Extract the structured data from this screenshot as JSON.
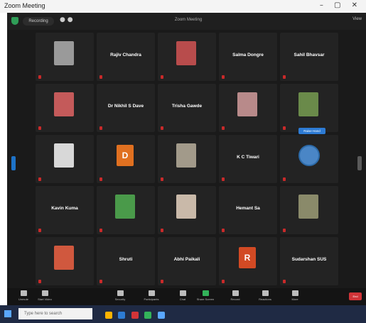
{
  "window": {
    "title": "Zoom Meeting",
    "controls": "– ▢ ✕"
  },
  "topbar": {
    "meeting_title": "Zoom Meeting",
    "view_label": "View",
    "pill_label": "Recording"
  },
  "tooltip": "Raise Hand",
  "tiles": [
    {
      "kind": "photo",
      "color": "#9a9a9a",
      "name": "..."
    },
    {
      "kind": "nameplate",
      "label": "Rajiv Chandra"
    },
    {
      "kind": "photo",
      "color": "#b84c4c",
      "name": "..."
    },
    {
      "kind": "nameplate",
      "label": "Salma Dongre"
    },
    {
      "kind": "nameplate",
      "label": "Sahil Bhavsar"
    },
    {
      "kind": "photo",
      "color": "#c45a5a",
      "name": "..."
    },
    {
      "kind": "nameplate",
      "label": "Dr Nikhil S Dave"
    },
    {
      "kind": "nameplate",
      "label": "Trisha Gawde"
    },
    {
      "kind": "photo",
      "color": "#b88a8a",
      "name": "..."
    },
    {
      "kind": "photo",
      "color": "#6a8a4a",
      "name": "..."
    },
    {
      "kind": "photo",
      "color": "#d8d8d8",
      "name": "..."
    },
    {
      "kind": "letter",
      "color": "#e07020",
      "letter": "D",
      "name": "..."
    },
    {
      "kind": "photo",
      "color": "#a29a8a",
      "name": "..."
    },
    {
      "kind": "nameplate",
      "label": "K C Tiwari"
    },
    {
      "kind": "circle",
      "name": "..."
    },
    {
      "kind": "nameplate",
      "label": "Kavin Kuma"
    },
    {
      "kind": "photo",
      "color": "#4a9a4a",
      "name": "..."
    },
    {
      "kind": "photo",
      "color": "#c9b9a9",
      "name": "..."
    },
    {
      "kind": "nameplate",
      "label": "Hemant Sa"
    },
    {
      "kind": "photo",
      "color": "#8a8a6a",
      "name": "..."
    },
    {
      "kind": "photo",
      "color": "#d0583e",
      "name": "..."
    },
    {
      "kind": "nameplate",
      "label": "Shruti"
    },
    {
      "kind": "nameplate",
      "label": "Abhi Paikali"
    },
    {
      "kind": "letter",
      "color": "#d24a24",
      "letter": "R",
      "name": "..."
    },
    {
      "kind": "nameplate",
      "label": "Sudarshan SUS"
    }
  ],
  "toolbar": [
    {
      "label": "Unmute",
      "icon": "microphone-icon"
    },
    {
      "label": "Start Video",
      "icon": "video-icon"
    },
    {
      "label": "Security",
      "icon": "shield-icon"
    },
    {
      "label": "Participants",
      "icon": "participants-icon"
    },
    {
      "label": "Chat",
      "icon": "chat-icon"
    },
    {
      "label": "Share Screen",
      "icon": "share-screen-icon"
    },
    {
      "label": "Record",
      "icon": "record-icon"
    },
    {
      "label": "Reactions",
      "icon": "reactions-icon"
    },
    {
      "label": "More",
      "icon": "more-icon"
    }
  ],
  "end_label": "End",
  "taskbar": {
    "search_placeholder": "Type here to search",
    "time": "..."
  },
  "colors": {
    "bg": "#1a1a1a",
    "tile": "#232323",
    "accent": "#2d7bd4",
    "end": "#d13438"
  }
}
